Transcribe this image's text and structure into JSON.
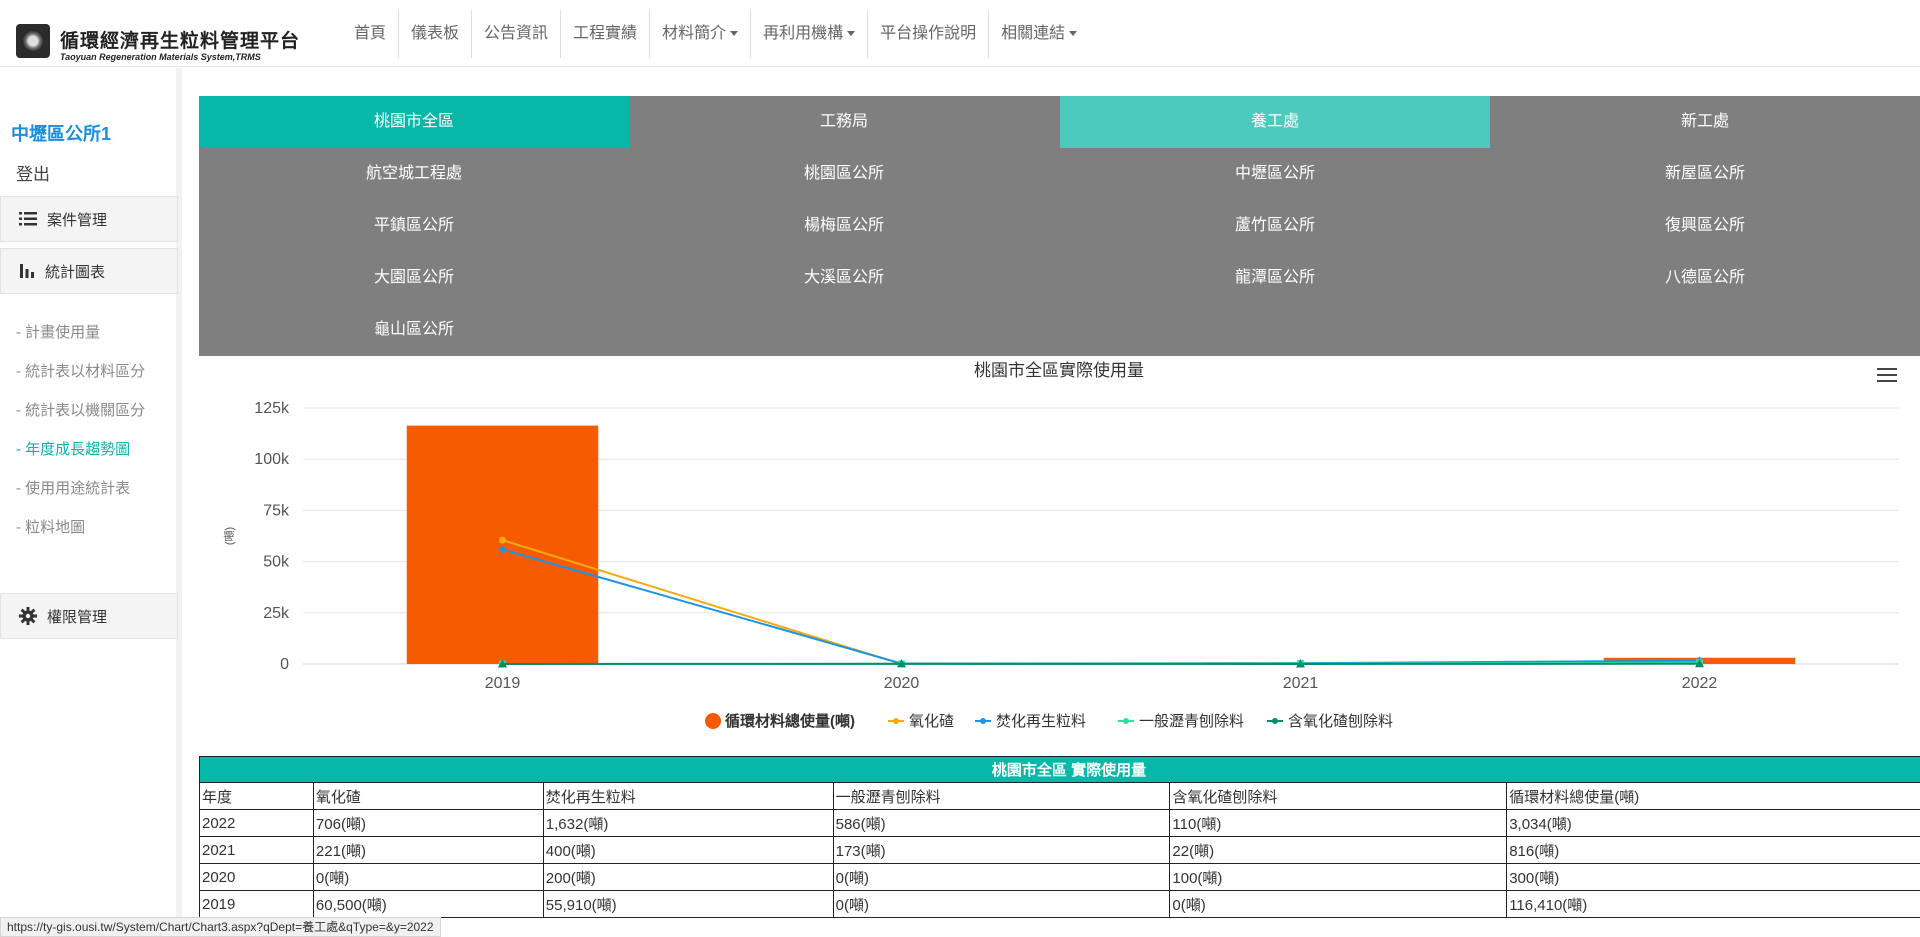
{
  "brand": {
    "title": "循環經濟再生粒料管理平台",
    "subtitle": "Taoyuan Regeneration Materials System,TRMS"
  },
  "nav": {
    "items": [
      {
        "label": "首頁",
        "dropdown": false
      },
      {
        "label": "儀表板",
        "dropdown": false
      },
      {
        "label": "公告資訊",
        "dropdown": false
      },
      {
        "label": "工程實績",
        "dropdown": false
      },
      {
        "label": "材料簡介",
        "dropdown": true
      },
      {
        "label": "再利用機構",
        "dropdown": true
      },
      {
        "label": "平台操作說明",
        "dropdown": false
      },
      {
        "label": "相關連結",
        "dropdown": true
      }
    ]
  },
  "sidebar": {
    "user": "中壢區公所1",
    "logout": "登出",
    "case_mgmt": "案件管理",
    "stats": "統計圖表",
    "sub_items": [
      {
        "label": "- 計畫使用量",
        "active": false
      },
      {
        "label": "- 統計表以材料區分",
        "active": false
      },
      {
        "label": "- 統計表以機關區分",
        "active": false
      },
      {
        "label": "- 年度成長趨勢圖",
        "active": true
      },
      {
        "label": "- 使用用途統計表",
        "active": false
      },
      {
        "label": "- 粒料地圖",
        "active": false
      }
    ],
    "permission": "權限管理"
  },
  "departments": [
    {
      "label": "桃園市全區",
      "state": "selected"
    },
    {
      "label": "工務局",
      "state": "normal"
    },
    {
      "label": "養工處",
      "state": "hover"
    },
    {
      "label": "新工處",
      "state": "normal"
    },
    {
      "label": "航空城工程處",
      "state": "normal"
    },
    {
      "label": "桃園區公所",
      "state": "normal"
    },
    {
      "label": "中壢區公所",
      "state": "normal"
    },
    {
      "label": "新屋區公所",
      "state": "normal"
    },
    {
      "label": "平鎮區公所",
      "state": "normal"
    },
    {
      "label": "楊梅區公所",
      "state": "normal"
    },
    {
      "label": "蘆竹區公所",
      "state": "normal"
    },
    {
      "label": "復興區公所",
      "state": "normal"
    },
    {
      "label": "大園區公所",
      "state": "normal"
    },
    {
      "label": "大溪區公所",
      "state": "normal"
    },
    {
      "label": "龍潭區公所",
      "state": "normal"
    },
    {
      "label": "八德區公所",
      "state": "normal"
    },
    {
      "label": "龜山區公所",
      "state": "normal"
    }
  ],
  "chart_data": {
    "type": "bar",
    "title": "桃園市全區實際使用量",
    "ylabel": "(噸)",
    "xlabel": "",
    "categories": [
      "2019",
      "2020",
      "2021",
      "2022"
    ],
    "ylim": [
      0,
      125000
    ],
    "yticks": [
      0,
      25000,
      50000,
      75000,
      100000,
      125000
    ],
    "ytick_labels": [
      "0",
      "25k",
      "50k",
      "75k",
      "100k",
      "125k"
    ],
    "grid": true,
    "legend_position": "bottom",
    "series": [
      {
        "name": "循環材料總使量(噸)",
        "kind": "bar",
        "color": "#f75b00",
        "values": [
          116410,
          300,
          816,
          3034
        ]
      },
      {
        "name": "氧化碴",
        "kind": "line",
        "color": "#f7a80d",
        "values": [
          60500,
          0,
          221,
          706
        ]
      },
      {
        "name": "焚化再生粒料",
        "kind": "line",
        "color": "#1c93e6",
        "values": [
          55910,
          200,
          400,
          1632
        ]
      },
      {
        "name": "一般瀝青刨除料",
        "kind": "line",
        "color": "#1ee8a0",
        "values": [
          0,
          0,
          173,
          586
        ]
      },
      {
        "name": "含氧化碴刨除料",
        "kind": "line",
        "color": "#0a8a6a",
        "values": [
          0,
          100,
          22,
          110
        ]
      }
    ]
  },
  "table": {
    "caption": "桃園市全區 實際使用量",
    "headers": [
      "年度",
      "氧化碴",
      "焚化再生粒料",
      "一般瀝青刨除料",
      "含氧化碴刨除料",
      "循環材料總使量(噸)"
    ],
    "rows": [
      [
        "2022",
        "706(噸)",
        "1,632(噸)",
        "586(噸)",
        "110(噸)",
        "3,034(噸)"
      ],
      [
        "2021",
        "221(噸)",
        "400(噸)",
        "173(噸)",
        "22(噸)",
        "816(噸)"
      ],
      [
        "2020",
        "0(噸)",
        "200(噸)",
        "0(噸)",
        "100(噸)",
        "300(噸)"
      ],
      [
        "2019",
        "60,500(噸)",
        "55,910(噸)",
        "0(噸)",
        "0(噸)",
        "116,410(噸)"
      ]
    ]
  },
  "statusbar": {
    "url": "https://ty-gis.ousi.tw/System/Chart/Chart3.aspx?qDept=養工處&qType=&y=2022"
  }
}
